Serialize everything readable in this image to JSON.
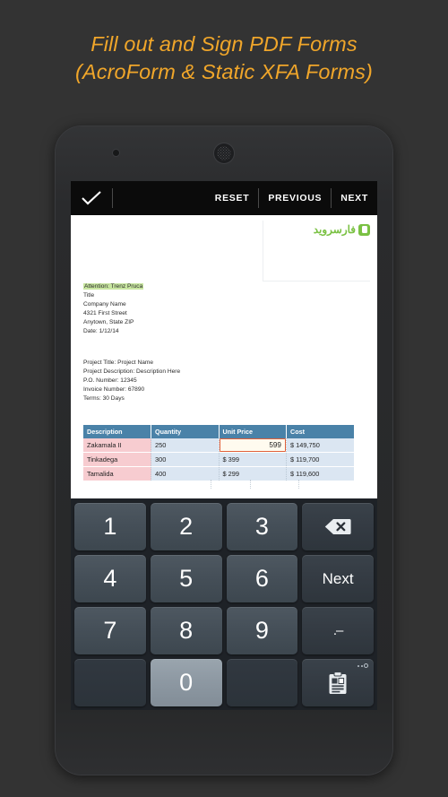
{
  "headline": {
    "text": "Fill out and Sign PDF Forms\n(AcroForm & Static XFA Forms)",
    "color": "#f0a62a"
  },
  "device": {
    "name": "android-phone-mockup",
    "body_color": "#2a2b2d",
    "screen_color": "#000000"
  },
  "app": {
    "toolbar": {
      "confirm_icon": "checkmark-icon",
      "reset_label": "RESET",
      "previous_label": "PREVIOUS",
      "next_label": "NEXT",
      "background": "#0b0b0b"
    },
    "document": {
      "watermark": {
        "text": "فارسروید",
        "color": "#7ac143",
        "icon": "farsroid-logo-icon"
      },
      "address_block": {
        "attention": "Attention: Trenz Pruca",
        "highlight_color": "#c8e6a0",
        "lines": [
          "Title",
          "Company Name",
          "4321 First Street",
          "Anytown, State ZIP",
          "Date: 1/12/14"
        ]
      },
      "project_block": {
        "lines": [
          "Project Title: Project Name",
          "Project Description: Description Here",
          "P.O. Number: 12345",
          "Invoice Number: 67890",
          "Terms: 30 Days"
        ]
      },
      "invoice_table": {
        "header_color": "#4a82a8",
        "desc_cell_color": "#f7ccd0",
        "num_cell_color": "#dbe6f2",
        "columns": [
          "Description",
          "Quantity",
          "Unit Price",
          "Cost"
        ],
        "rows": [
          {
            "description": "Zakamala II",
            "quantity": "250",
            "unit_price": "599",
            "unit_price_active": true,
            "cost": "$ 149,750"
          },
          {
            "description": "Tinkadega",
            "quantity": "300",
            "unit_price": "$ 399",
            "unit_price_active": false,
            "cost": "$ 119,700"
          },
          {
            "description": "Tamalida",
            "quantity": "400",
            "unit_price": "$ 299",
            "unit_price_active": false,
            "cost": "$ 119,600"
          }
        ],
        "active_field": {
          "value": "599",
          "border_color": "#e0603a",
          "background": "#fffbef"
        }
      }
    },
    "keyboard": {
      "background": "#1e2227",
      "rows": [
        [
          {
            "label": "1",
            "name": "key-1",
            "type": "digit"
          },
          {
            "label": "2",
            "name": "key-2",
            "type": "digit"
          },
          {
            "label": "3",
            "name": "key-3",
            "type": "digit"
          },
          {
            "label": "",
            "name": "backspace-key",
            "type": "backspace-icon"
          }
        ],
        [
          {
            "label": "4",
            "name": "key-4",
            "type": "digit"
          },
          {
            "label": "5",
            "name": "key-5",
            "type": "digit"
          },
          {
            "label": "6",
            "name": "key-6",
            "type": "digit"
          },
          {
            "label": "Next",
            "name": "next-key",
            "type": "fn"
          }
        ],
        [
          {
            "label": "7",
            "name": "key-7",
            "type": "digit"
          },
          {
            "label": "8",
            "name": "key-8",
            "type": "digit"
          },
          {
            "label": "9",
            "name": "key-9",
            "type": "digit"
          },
          {
            "label": ".–",
            "name": "dot-dash-key",
            "type": "dotdash"
          }
        ],
        [
          {
            "label": "",
            "name": "blank-key-left",
            "type": "blank"
          },
          {
            "label": "0",
            "name": "key-0",
            "type": "zero"
          },
          {
            "label": "",
            "name": "blank-key-right",
            "type": "blank"
          },
          {
            "label": "",
            "name": "clipboard-key",
            "type": "clipboard-icon"
          }
        ]
      ]
    }
  }
}
